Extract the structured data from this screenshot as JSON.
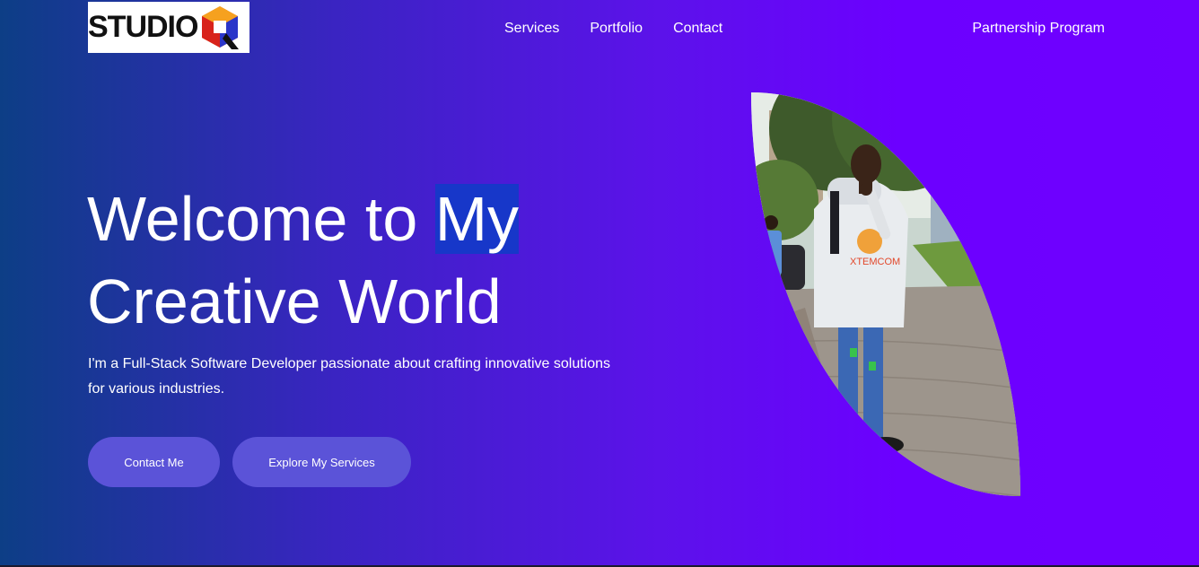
{
  "header": {
    "logo_text": "STUDIO",
    "nav": [
      {
        "label": "Services"
      },
      {
        "label": "Portfolio"
      },
      {
        "label": "Contact"
      }
    ],
    "partnership_label": "Partnership Program"
  },
  "hero": {
    "title_line1_a": "Welcome to ",
    "title_line1_highlight": "My",
    "title_line2": "Creative World",
    "description": "I'm a Full-Stack Software Developer passionate about crafting innovative solutions for various industries.",
    "buttons": {
      "contact_label": "Contact Me",
      "services_label": "Explore My Services"
    },
    "photo_shirt_text": "XTEMCOM"
  },
  "colors": {
    "gradient_start": "#0d3e86",
    "gradient_end": "#6f00ff",
    "button_bg": "#5b53d8",
    "highlight_bg": "#1737c9"
  }
}
